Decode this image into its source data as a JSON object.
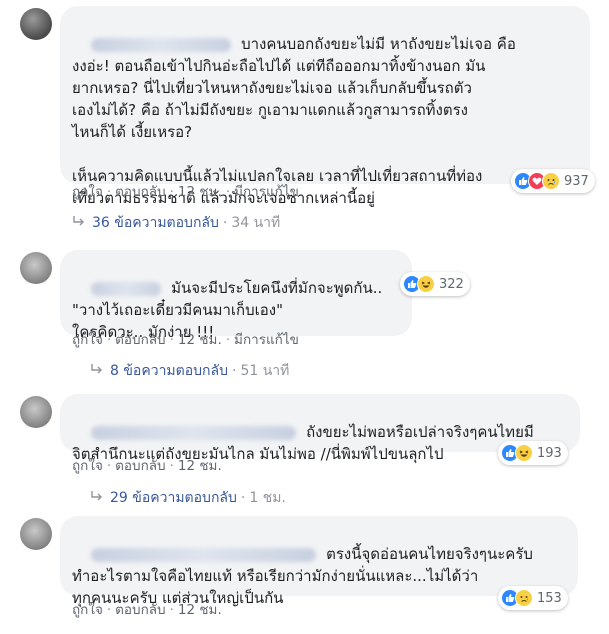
{
  "comments": [
    {
      "text": "บางคนบอกถังขยะไม่มี หาถังขยะไม่เจอ คือ\nงงอ่ะ! ตอนถือเข้าไปกินอ่ะถือไปได้ แต่ทีถือออกมาทิ้งข้างนอก มัน\nยากเหรอ? นี่ไปเที่ยวไหนหาถังขยะไม่เจอ แล้วเก็บกลับขึ้นรถตัว\nเองไม่ได้? คือ ถ้าไม่มีถังขยะ กูเอามาแดกแล้วกูสามารถทิ้งตรง\nไหนก็ได้ เงี้ยเหรอ?\n\nเห็นความคิดแบบนี้แล้วไม่แปลกใจเลย เวลาที่ไปเที่ยวสถานที่ท่อง\nเที่ยวตามธรรมชาติ แล้วมักจะเจอซากเหล่านี้อยู่",
      "actions": {
        "like": "ถูกใจ",
        "reply": "ตอบกลับ",
        "time": "12 ชม.",
        "edited": "มีการแก้ไข"
      },
      "reactions": {
        "icons": [
          "like-icon",
          "love-icon",
          "sad-icon"
        ],
        "count": "937"
      },
      "replies": {
        "label": "36 ข้อความตอบกลับ",
        "time": "34 นาที"
      }
    },
    {
      "text": "มันจะมีประโยคนึงที่มักจะพูดกัน..\n\"วางไว้เถอะเดี๋ยวมีคนมาเก็บเอง\"\nใครคิดวะ.. มักง่าย !!!",
      "actions": {
        "like": "ถูกใจ",
        "reply": "ตอบกลับ",
        "time": "12 ชม.",
        "edited": "มีการแก้ไข"
      },
      "reactions": {
        "icons": [
          "like-icon",
          "haha-icon"
        ],
        "count": "322"
      },
      "replies": {
        "label": "8 ข้อความตอบกลับ",
        "time": "51 นาที"
      }
    },
    {
      "text": "ถังขยะไม่พอหรือเปล่าจริงๆคนไทยมี\nจิตสำนึกนะแต่ถังขยะมันไกล มันไม่พอ //นี่พิมพ์ไปขนลุกไป",
      "actions": {
        "like": "ถูกใจ",
        "reply": "ตอบกลับ",
        "time": "12 ชม."
      },
      "reactions": {
        "icons": [
          "like-icon",
          "haha-icon"
        ],
        "count": "193"
      },
      "replies": {
        "label": "29 ข้อความตอบกลับ",
        "time": "1 ชม."
      }
    },
    {
      "text": "ตรงนี้จุดอ่อนคนไทยจริงๆนะครับ\nทำอะไรตามใจคือไทยแท้ หรือเรียกว่ามักง่ายนั่นแหละ...ไม่ได้ว่า\nทุกคนนะครับ แต่ส่วนใหญ่เป็นกัน",
      "actions": {
        "like": "ถูกใจ",
        "reply": "ตอบกลับ",
        "time": "12 ชม."
      },
      "reactions": {
        "icons": [
          "like-icon",
          "sad-icon"
        ],
        "count": "153"
      }
    }
  ]
}
